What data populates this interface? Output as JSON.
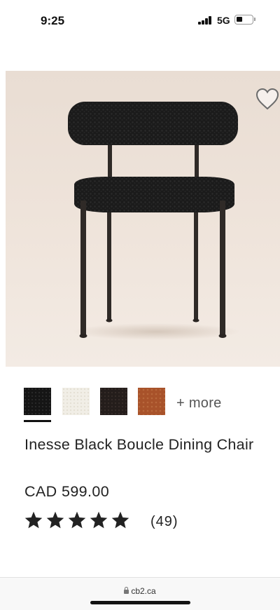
{
  "status_bar": {
    "time": "9:25",
    "network": "5G"
  },
  "product": {
    "image_alt": "Inesse Black Boucle Dining Chair product photo",
    "favorite_icon": "heart-outline-icon",
    "swatches": [
      {
        "name": "black-boucle",
        "color": "#1d1d1d",
        "selected": true
      },
      {
        "name": "cream-boucle",
        "color": "#efebe2",
        "selected": false
      },
      {
        "name": "dark-brown",
        "color": "#2a2220",
        "selected": false
      },
      {
        "name": "cognac",
        "color": "#a9542c",
        "selected": false
      }
    ],
    "more_label": "+ more",
    "title": "Inesse Black Boucle Dining Chair",
    "price": "CAD 599.00",
    "rating": 5,
    "review_count": "(49)"
  },
  "browser": {
    "url": "cb2.ca"
  }
}
